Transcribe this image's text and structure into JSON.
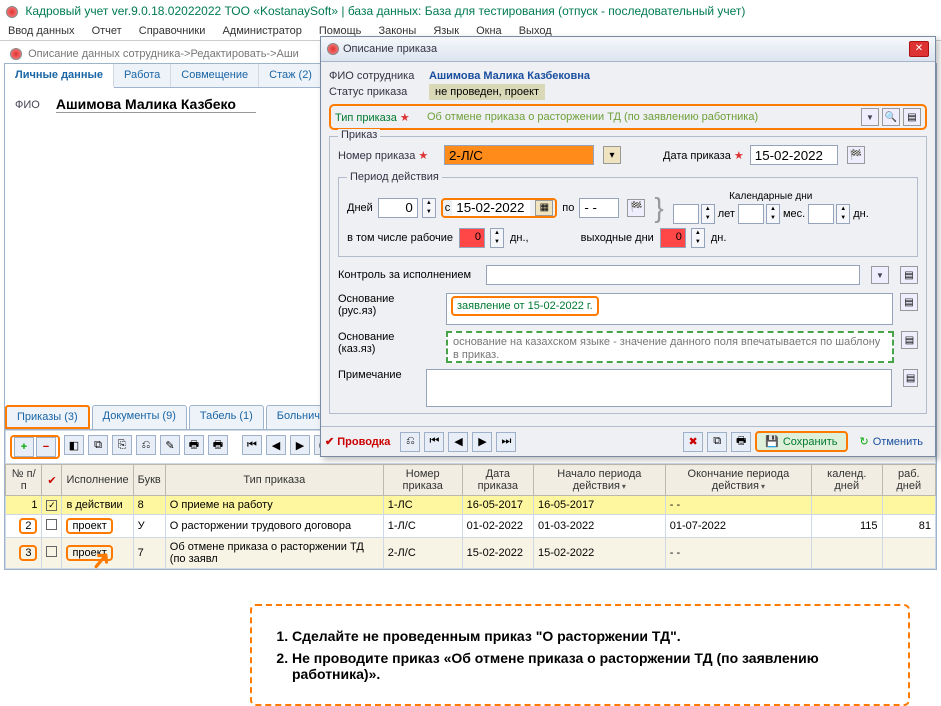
{
  "app": {
    "title": "Кадровый учет ver.9.0.18.02022022 ТОО «KostanaySoft» | база данных: База для тестирования (отпуск - последовательный учет)"
  },
  "menu": [
    "Ввод данных",
    "Отчет",
    "Справочники",
    "Администратор",
    "Помощь",
    "Законы",
    "Язык",
    "Окна",
    "Выход"
  ],
  "crumb": "Описание данных сотрудника->Редактировать->Аши",
  "upper_tabs": {
    "active": "Личные данные",
    "items": [
      "Личные данные",
      "Работа",
      "Совмещение",
      "Стаж (2)"
    ]
  },
  "employee": {
    "label": "ФИО",
    "name": "Ашимова Малика Казбеко"
  },
  "modal": {
    "title": "Описание приказа",
    "fio_label": "ФИО сотрудника",
    "fio": "Ашимова Малика Казбековна",
    "status_label": "Статус приказа",
    "status": "не проведен, проект",
    "type_label": "Тип приказа",
    "type_val": "Об отмене приказа о расторжении ТД (по заявлению работника)",
    "grp_order": "Приказ",
    "num_label": "Номер приказа",
    "num": "2-Л/С",
    "date_label": "Дата приказа",
    "date": "15-02-2022",
    "grp_period": "Период действия",
    "days_label": "Дней",
    "days": "0",
    "from_lbl": "с",
    "from": "15-02-2022",
    "to_lbl": "по",
    "to": "- -",
    "cal_days": "Календарные дни",
    "years": "лет",
    "months": "мес.",
    "d": "дн.",
    "work_label": "в том числе рабочие",
    "work_val": "0",
    "work_unit": "дн.,",
    "weekend_label": "выходные дни",
    "weekend_val": "0",
    "weekend_unit": "дн.",
    "ctrl_label": "Контроль за исполнением",
    "osn_ru_label": "Основание\n(рус.яз)",
    "osn_ru": "заявление от 15-02-2022 г.",
    "osn_kz_label": "Основание\n(каз.яз)",
    "osn_kz": "основание на казахском языке - значение данного поля впечатывается по шаблону в приказ.",
    "note_label": "Примечание",
    "provodka": "✔ Проводка",
    "save": "Сохранить",
    "cancel": "Отменить"
  },
  "lower_tabs": [
    "Приказы (3)",
    "Документы (9)",
    "Табель (1)",
    "Больничн"
  ],
  "table": {
    "headers": [
      "№ п/п",
      "",
      "Исполнение",
      "Букв",
      "Тип приказа",
      "Номер приказа",
      "Дата приказа",
      "Начало периода действия",
      "Окончание периода действия",
      "календ. дней",
      "раб. дней"
    ],
    "rows": [
      {
        "n": "1",
        "chk": true,
        "exec": "в действии",
        "bukv": "8",
        "type": "О приеме на работу",
        "num": "1-ЛС",
        "date": "16-05-2017",
        "start": "16-05-2017",
        "end": "- -",
        "cal": "",
        "work": ""
      },
      {
        "n": "2",
        "chk": false,
        "exec": "проект",
        "bukv": "У",
        "type": "О расторжении трудового договора",
        "num": "1-Л/С",
        "date": "01-02-2022",
        "start": "01-03-2022",
        "end": "01-07-2022",
        "cal": "115",
        "work": "81"
      },
      {
        "n": "3",
        "chk": false,
        "exec": "проект",
        "bukv": "7",
        "type": "Об отмене приказа о расторжении ТД (по заявл",
        "num": "2-Л/С",
        "date": "15-02-2022",
        "start": "15-02-2022",
        "end": "- -",
        "cal": "",
        "work": ""
      }
    ]
  },
  "notes": {
    "n1": "Сделайте не проведенным приказ \"О расторжении ТД\".",
    "n2": "Не проводите приказ «Об отмене приказа о расторжении ТД (по заявлению работника)»."
  }
}
